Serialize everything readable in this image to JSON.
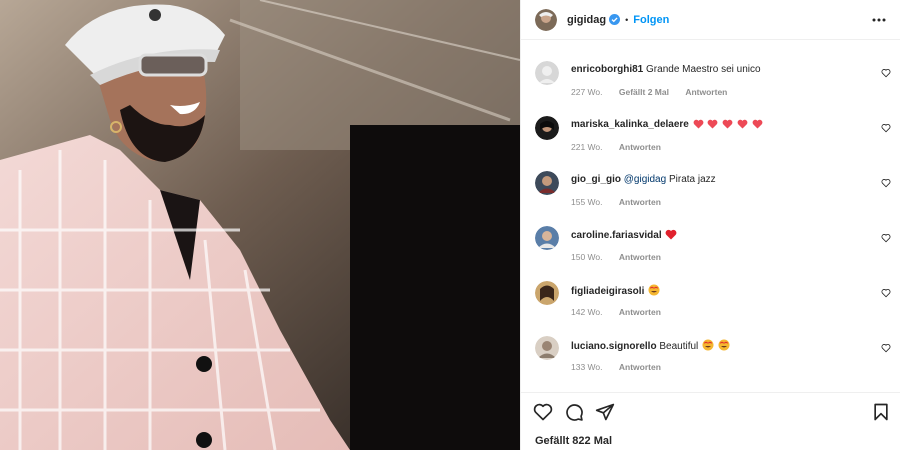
{
  "header": {
    "username": "gigidag",
    "separator": "•",
    "follow_label": "Folgen",
    "icons": [
      "avatar",
      "verified-badge-icon",
      "more-options-icon"
    ]
  },
  "comments": [
    {
      "user": "enricoborghi81",
      "text": "Grande Maestro sei unico",
      "emojis": [],
      "time": "227 Wo.",
      "likes": "Gefällt 2 Mal",
      "reply": "Antworten"
    },
    {
      "user": "mariska_kalinka_delaere",
      "text": "",
      "emojis": [
        "heart-red",
        "heart-red",
        "heart-red",
        "heart-red",
        "heart-red"
      ],
      "time": "221 Wo.",
      "likes": "",
      "reply": "Antworten"
    },
    {
      "user": "gio_gi_gio",
      "mention": "@gigidag",
      "text": "Pirata jazz",
      "emojis": [],
      "time": "155 Wo.",
      "likes": "",
      "reply": "Antworten"
    },
    {
      "user": "caroline.fariasvidal",
      "text": "",
      "emojis": [
        "heart-red"
      ],
      "time": "150 Wo.",
      "likes": "",
      "reply": "Antworten"
    },
    {
      "user": "figliadeigirasoli",
      "text": "",
      "emojis": [
        "heart-eyes"
      ],
      "time": "142 Wo.",
      "likes": "",
      "reply": "Antworten"
    },
    {
      "user": "luciano.signorello",
      "text": "Beautiful",
      "emojis": [
        "heart-eyes",
        "heart-eyes"
      ],
      "time": "133 Wo.",
      "likes": "",
      "reply": "Antworten"
    }
  ],
  "footer": {
    "likes_label": "Gefällt 822 Mal",
    "icons": [
      "like-heart-icon",
      "comment-icon",
      "share-icon",
      "bookmark-icon"
    ]
  },
  "colors": {
    "link": "#0095f6",
    "text": "#262626",
    "muted": "#8e8e8e",
    "heart": "#ed4956"
  }
}
